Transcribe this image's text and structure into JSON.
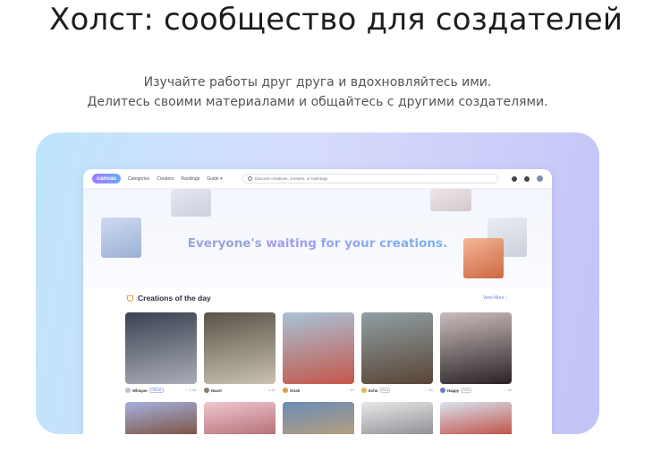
{
  "page": {
    "title": "Холст: сообщество для создателей",
    "subtitle_line1": "Изучайте работы друг друга и вдохновляйтесь ими.",
    "subtitle_line2": "Делитесь своими материалами и общайтесь с другими создателями."
  },
  "colors": {
    "showcase_gradient": [
      "#bfe5fb",
      "#d6dcfb",
      "#c3c3f7"
    ],
    "accent": "#6a7de6",
    "logo_gradient": [
      "#9b7bff",
      "#6fa8ff"
    ]
  },
  "app": {
    "logo": "canvas",
    "nav": [
      "Categories",
      "Creators",
      "Rankings",
      "Guide"
    ],
    "search_placeholder": "Discover creations, creators, or hashtags",
    "toolbar_icons": [
      "globe-icon",
      "bell-icon",
      "avatar"
    ],
    "hero": {
      "text_lead": "Everyone's ",
      "text_highlight": "waiting for your creations."
    },
    "section": {
      "title": "Creations of the day",
      "view_more": "View More ›"
    },
    "cards": [
      {
        "name": "Whisper",
        "badge": "Official",
        "likes": "1.8K",
        "colors": [
          "#3b4150",
          "#a9adb8"
        ],
        "avatar_color": "#b8c3d6"
      },
      {
        "name": "Hanel",
        "badge": "",
        "likes": "3.4K",
        "colors": [
          "#5a5448",
          "#c9c1b2"
        ],
        "avatar_color": "#8c7b6b"
      },
      {
        "name": "Oriah",
        "badge": "",
        "likes": "4K",
        "colors": [
          "#a8c3d8",
          "#c4574a"
        ],
        "avatar_color": "#e39a4a"
      },
      {
        "name": "Echo",
        "badge": "Beta",
        "likes": "3K",
        "colors": [
          "#8f9fa3",
          "#5a4536"
        ],
        "avatar_color": "#e8b35a"
      },
      {
        "name": "Happy",
        "badge": "Beta",
        "likes": "54",
        "colors": [
          "#cbbcbc",
          "#2a2326"
        ],
        "avatar_color": "#6b7fc4"
      }
    ],
    "row2_colors": [
      [
        "#a6b0e0",
        "#7a4f3a"
      ],
      [
        "#f0c7cf",
        "#b26b73"
      ],
      [
        "#6b8cb7",
        "#b9a07a"
      ],
      [
        "#e8e8ea",
        "#8b8b8f"
      ],
      [
        "#d8e4ef",
        "#c0473c"
      ]
    ]
  }
}
